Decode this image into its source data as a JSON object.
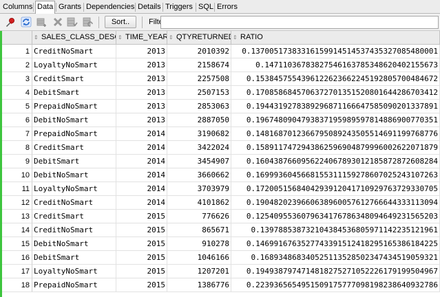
{
  "tabs": [
    {
      "label": "Columns",
      "active": false
    },
    {
      "label": "Data",
      "active": true
    },
    {
      "label": "Grants",
      "active": false
    },
    {
      "label": "Dependencies",
      "active": false
    },
    {
      "label": "Details",
      "active": false
    },
    {
      "label": "Triggers",
      "active": false
    },
    {
      "label": "SQL",
      "active": false
    },
    {
      "label": "Errors",
      "active": false
    }
  ],
  "toolbar": {
    "icons": [
      "pin-icon",
      "refresh-icon",
      "insert-row-icon",
      "delete-row-icon",
      "commit-icon",
      "rollback-icon"
    ],
    "sort_label": "Sort..",
    "filter_label": "Filter:",
    "filter_value": ""
  },
  "colors": {
    "accent_green": "#3ec53e",
    "header_bg": "#ebebeb",
    "pin_red": "#d42020",
    "refresh_blue": "#2e6fd0"
  },
  "table": {
    "columns": [
      "SALES_CLASS_DESC",
      "TIME_YEAR",
      "QTYRETURNED",
      "RATIO"
    ],
    "rows": [
      [
        "1",
        "Credit NoSmart",
        "2013",
        "2010392",
        "0.13700517383316159914514537435327085480001"
      ],
      [
        "2",
        "Loyalty NoSmart",
        "2013",
        "2158674",
        "0.14711036783827546163785348620402155673"
      ],
      [
        "3",
        "Credit Smart",
        "2013",
        "2257508",
        "0.15384575543961226236622451928057004846 72"
      ],
      [
        "4",
        "Debit Smart",
        "2013",
        "2507153",
        "0.17085868457063727013515208016442867034 12"
      ],
      [
        "5",
        "Prepaid NoSmart",
        "2013",
        "2853063",
        "0.19443192783892968711666475850902013378 91"
      ],
      [
        "6",
        "Debit NoSmart",
        "2013",
        "2887050",
        "0.19674809047938371959895978148869007703 51"
      ],
      [
        "7",
        "Prepaid NoSmart",
        "2014",
        "3190682",
        "0.14816870123667950892435055146911997687 76"
      ],
      [
        "8",
        "Credit Smart",
        "2014",
        "3422024",
        "0.15891174729438625969048799960026220718 79"
      ],
      [
        "9",
        "Debit Smart",
        "2014",
        "3454907",
        "0.16043876609562240678930121858728726082 84"
      ],
      [
        "10",
        "Debit NoSmart",
        "2014",
        "3660662",
        "0.16999360456681553111592786070252431072 63"
      ],
      [
        "11",
        "Loyalty NoSmart",
        "2014",
        "3703979",
        "0.17200515684042939120417109297637293307 05"
      ],
      [
        "12",
        "Credit NoSmart",
        "2014",
        "4101862",
        "0.19048202396606389600576127666443331130 94"
      ],
      [
        "13",
        "Credit Smart",
        "2015",
        "776626",
        "0.12540955360796341767863480946492315652 03"
      ],
      [
        "14",
        "Credit NoSmart",
        "2015",
        "865671",
        "0.13978853873210438453680597114223512196 1"
      ],
      [
        "15",
        "Debit NoSmart",
        "2015",
        "910278",
        "0.14699167635277433915124182951653861842 25"
      ],
      [
        "16",
        "Debit Smart",
        "2015",
        "1046166",
        "0.16893486834052511352850234743451905932 1"
      ],
      [
        "17",
        "Loyalty NoSmart",
        "2015",
        "1207201",
        "0.19493879747148182752710522261791995049 67"
      ],
      [
        "18",
        "Prepaid NoSmart",
        "2015",
        "1386776",
        "0.22393656549515091757770981982386409327 86"
      ]
    ]
  }
}
